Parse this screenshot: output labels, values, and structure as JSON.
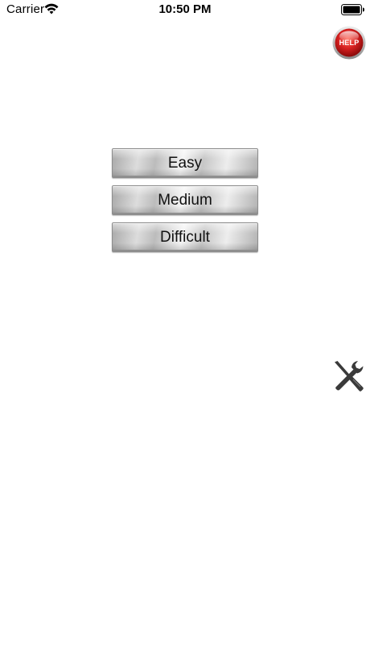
{
  "status_bar": {
    "carrier": "Carrier",
    "time": "10:50 PM"
  },
  "help_button": {
    "label": "HELP",
    "icon": "help-badge-icon",
    "color": "#d62020"
  },
  "difficulty_buttons": [
    {
      "label": "Easy"
    },
    {
      "label": "Medium"
    },
    {
      "label": "Difficult"
    }
  ],
  "settings_button": {
    "icon": "tools-icon",
    "color": "#3a3a3a"
  }
}
